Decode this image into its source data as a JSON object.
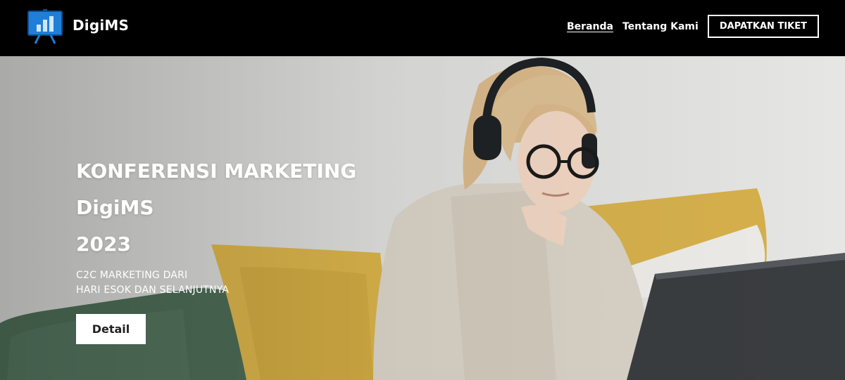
{
  "header": {
    "brand": "DigiMS",
    "logo_icon": "presentation-board-icon",
    "nav": [
      {
        "label": "Beranda",
        "active": true
      },
      {
        "label": "Tentang Kami",
        "active": false
      }
    ],
    "cta_label": "DAPATKAN TIKET"
  },
  "hero": {
    "title_lines": [
      "KONFERENSI MARKETING",
      "DigiMS",
      "2023"
    ],
    "subtitle_lines": [
      "C2C MARKETING DARI",
      "HARI ESOK DAN SELANJUTNYA"
    ],
    "button_label": "Detail",
    "image_subject": "woman-with-headphones-laptop-photo"
  },
  "colors": {
    "header_bg": "#000000",
    "wall": "#dcdcda",
    "pillow_yellow": "#d8b24a",
    "pillow_green": "#4c6b55",
    "sweater": "#d9d2c6",
    "laptop": "#3a3d40"
  }
}
